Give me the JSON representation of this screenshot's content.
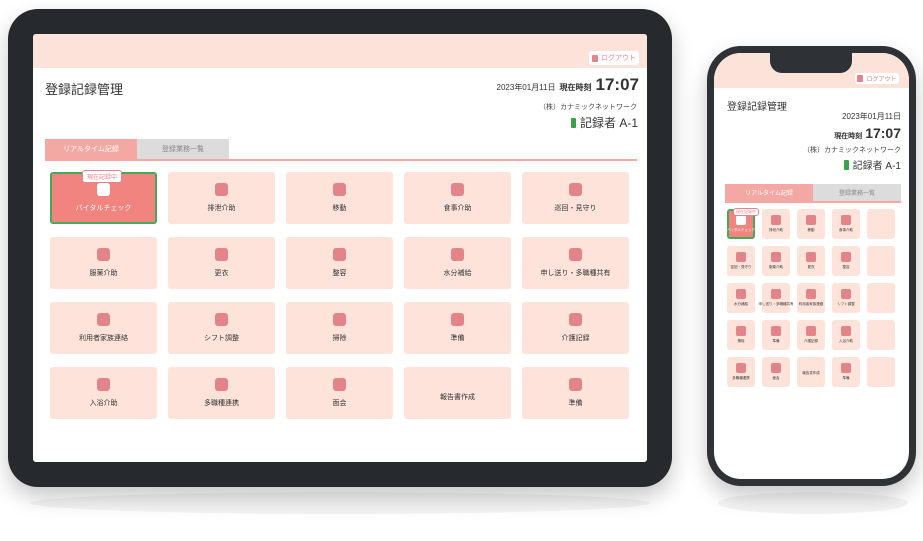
{
  "colors": {
    "accent": "#f1847f",
    "tile_bg": "#fde3da",
    "header_bg": "#fbe3d9",
    "tab_active": "#f3a8a3",
    "tab_inactive": "#dcdcdc",
    "active_border": "#46a859"
  },
  "tablet": {
    "logout_label": "ログアウト",
    "app_title": "登録記録管理",
    "date": "2023年01月11日",
    "now_label": "現在時刻",
    "time": "17:07",
    "company": "（株）カナミックネットワーク",
    "recorder": "記録者 A-1",
    "tabs": [
      {
        "label": "リアルタイム記録",
        "active": true
      },
      {
        "label": "登録業務一覧",
        "active": false
      }
    ],
    "bubble": "現在記録中",
    "tiles": [
      {
        "label": "バイタルチェック",
        "icon": "heart-rate-icon",
        "active": true
      },
      {
        "label": "排泄介助",
        "icon": "toilet-icon"
      },
      {
        "label": "移動",
        "icon": "walking-assist-icon"
      },
      {
        "label": "食事介助",
        "icon": "fork-knife-icon"
      },
      {
        "label": "巡回・見守り",
        "icon": "nurse-icon"
      },
      {
        "label": "服薬介助",
        "icon": "pill-icon"
      },
      {
        "label": "更衣",
        "icon": "shirt-icon"
      },
      {
        "label": "整容",
        "icon": "hair-dryer-icon"
      },
      {
        "label": "水分補給",
        "icon": "water-drop-icon"
      },
      {
        "label": "申し送り・多職種共有",
        "icon": "chat-icon"
      },
      {
        "label": "利用者家族連絡",
        "icon": "phone-icon"
      },
      {
        "label": "シフト調整",
        "icon": "calendar-icon"
      },
      {
        "label": "掃除",
        "icon": "broom-icon"
      },
      {
        "label": "準備",
        "icon": "edit-note-icon"
      },
      {
        "label": "介護記録",
        "icon": "pencil-icon"
      },
      {
        "label": "入浴介助",
        "icon": "bath-icon"
      },
      {
        "label": "多職種連携",
        "icon": "chat-icon"
      },
      {
        "label": "面会",
        "icon": "phone-icon"
      },
      {
        "label": "報告書作成",
        "icon": "none"
      },
      {
        "label": "準備",
        "icon": "edit-note-icon"
      }
    ]
  },
  "phone": {
    "logout_label": "ログアウト",
    "app_title": "登録記録管理",
    "date": "2023年01月11日",
    "now_label": "現在時刻",
    "time": "17:07",
    "company": "（株）カナミックネットワーク",
    "recorder": "記録者 A-1",
    "tabs": [
      {
        "label": "リアルタイム記録",
        "active": true
      },
      {
        "label": "登録業務一覧",
        "active": false
      }
    ],
    "bubble": "現在記録中",
    "tiles": [
      {
        "label": "バイタルチェック",
        "icon": "heart-rate-icon",
        "active": true
      },
      {
        "label": "排泄介助",
        "icon": "toilet-icon"
      },
      {
        "label": "移動",
        "icon": "walking-assist-icon"
      },
      {
        "label": "食事介助",
        "icon": "fork-knife-icon"
      },
      {
        "label": "",
        "icon": "blank"
      },
      {
        "label": "巡回・見守り",
        "icon": "nurse-icon"
      },
      {
        "label": "服薬介助",
        "icon": "pill-icon"
      },
      {
        "label": "更衣",
        "icon": "shirt-icon"
      },
      {
        "label": "整容",
        "icon": "hair-dryer-icon"
      },
      {
        "label": "",
        "icon": "blank"
      },
      {
        "label": "水分補給",
        "icon": "water-drop-icon"
      },
      {
        "label": "申し送り・多職種共有",
        "icon": "chat-icon"
      },
      {
        "label": "利用者家族連絡",
        "icon": "phone-icon"
      },
      {
        "label": "シフト調整",
        "icon": "calendar-icon"
      },
      {
        "label": "",
        "icon": "blank"
      },
      {
        "label": "掃除",
        "icon": "broom-icon"
      },
      {
        "label": "準備",
        "icon": "edit-note-icon"
      },
      {
        "label": "介護記録",
        "icon": "pencil-icon"
      },
      {
        "label": "入浴介助",
        "icon": "bath-icon"
      },
      {
        "label": "",
        "icon": "blank"
      },
      {
        "label": "多職種連携",
        "icon": "chat-icon"
      },
      {
        "label": "面会",
        "icon": "phone-icon"
      },
      {
        "label": "報告書作成",
        "icon": "none"
      },
      {
        "label": "準備",
        "icon": "edit-note-icon"
      },
      {
        "label": "",
        "icon": "blank"
      }
    ]
  }
}
